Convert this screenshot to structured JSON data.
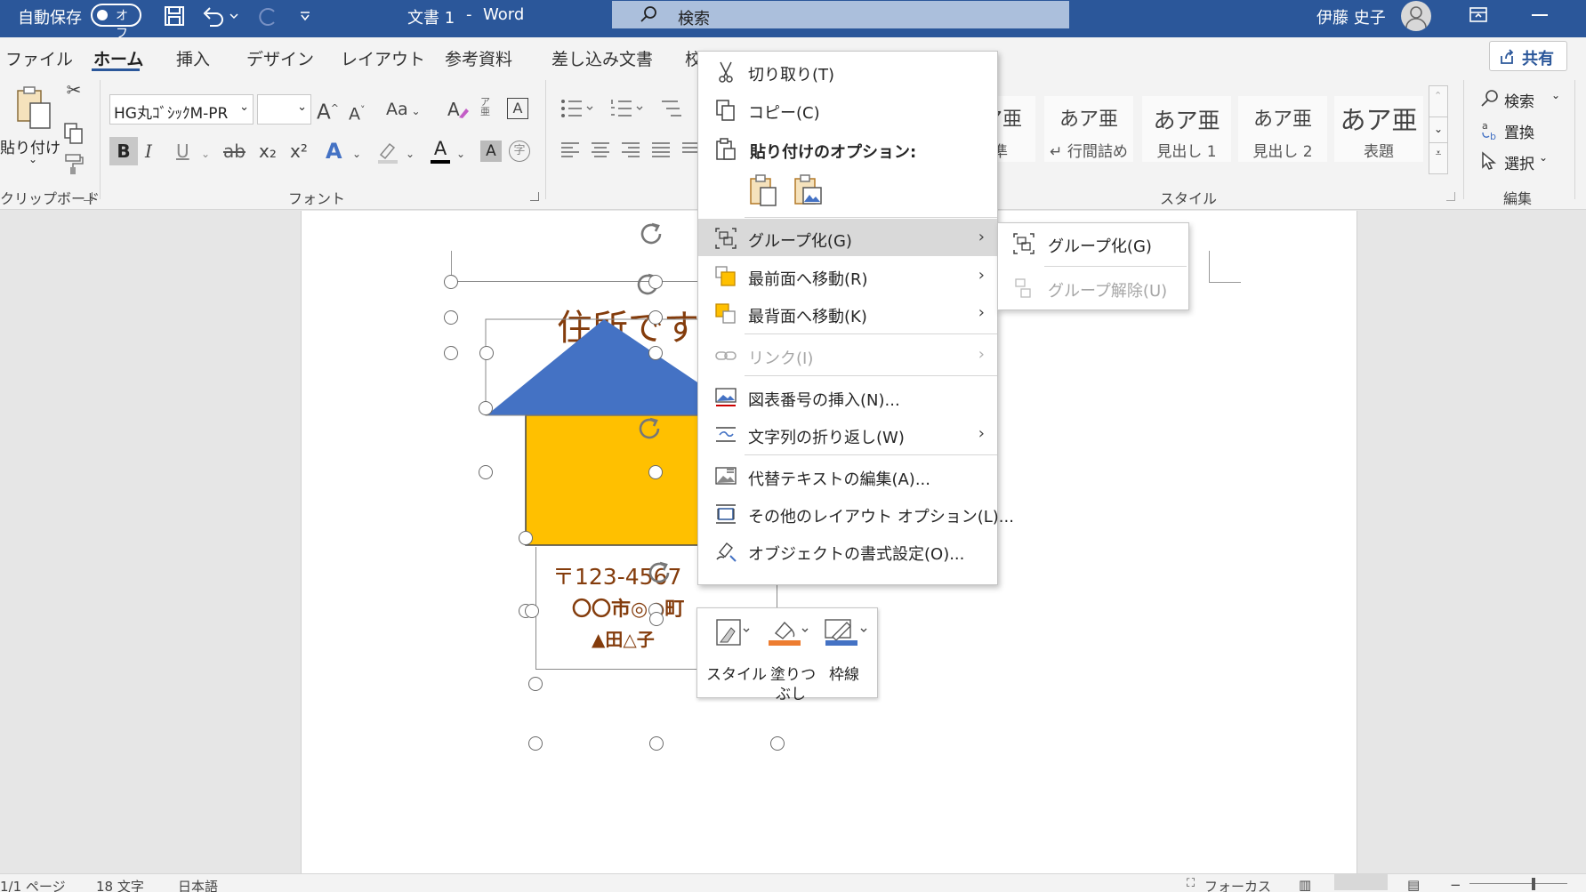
{
  "titlebar": {
    "autosave_label": "自動保存",
    "autosave_state": "オフ",
    "doc_title": "文書 1",
    "separator": "-",
    "app_name": "Word",
    "search_placeholder": "検索",
    "user_name": "伊藤 史子"
  },
  "tabs": [
    "ファイル",
    "ホーム",
    "挿入",
    "デザイン",
    "レイアウト",
    "参考資料",
    "差し込み文書",
    "校閲"
  ],
  "active_tab": "ホーム",
  "share_label": "共有",
  "ribbon": {
    "clipboard": {
      "paste_label": "貼り付け",
      "group_label": "クリップボード"
    },
    "font": {
      "font_name": "HG丸ｺﾞｼｯｸM-PR",
      "font_size": "",
      "group_label": "フォント",
      "glyphs": {
        "grow": "A",
        "shrink": "A",
        "case": "Aa",
        "bold": "B",
        "italic": "I",
        "underline": "U",
        "strike": "ab",
        "sub": "x₂",
        "sup": "x²",
        "effect": "A",
        "highlight": "✎",
        "color": "A",
        "char_shade": "A",
        "enclose": "字"
      }
    },
    "styles": {
      "items": [
        {
          "preview": "あア亜",
          "name": "標準"
        },
        {
          "preview": "あア亜",
          "name": "↵ 行間詰め"
        },
        {
          "preview": "あア亜",
          "name": "見出し 1"
        },
        {
          "preview": "あア亜",
          "name": "見出し 2"
        },
        {
          "preview": "あア亜",
          "name": "表題"
        }
      ],
      "group_label": "スタイル"
    },
    "editing": {
      "find": "検索",
      "replace": "置換",
      "select": "選択",
      "group_label": "編集"
    }
  },
  "document": {
    "title_text": "住所です",
    "postal": "〒123-4567",
    "address": "〇〇市◎◎町",
    "name": "▲田△子",
    "colors": {
      "roof": "#4472c4",
      "body": "#ffc000",
      "title": "#843c0c",
      "address": "#843c0c"
    }
  },
  "context_menu": {
    "items": [
      {
        "label": "切り取り(T)",
        "icon": "scissors-icon",
        "enabled": true,
        "submenu": false
      },
      {
        "label": "コピー(C)",
        "icon": "copy-icon",
        "enabled": true,
        "submenu": false
      },
      {
        "label": "貼り付けのオプション:",
        "icon": "paste-icon",
        "enabled": true,
        "submenu": false
      },
      {
        "label": "グループ化(G)",
        "icon": "group-icon",
        "enabled": true,
        "submenu": true,
        "highlighted": true
      },
      {
        "label": "最前面へ移動(R)",
        "icon": "bring-front-icon",
        "enabled": true,
        "submenu": true
      },
      {
        "label": "最背面へ移動(K)",
        "icon": "send-back-icon",
        "enabled": true,
        "submenu": true
      },
      {
        "label": "リンク(I)",
        "icon": "link-icon",
        "enabled": false,
        "submenu": true
      },
      {
        "label": "図表番号の挿入(N)...",
        "icon": "caption-icon",
        "enabled": true,
        "submenu": false
      },
      {
        "label": "文字列の折り返し(W)",
        "icon": "wrap-text-icon",
        "enabled": true,
        "submenu": true
      },
      {
        "label": "代替テキストの編集(A)...",
        "icon": "alt-text-icon",
        "enabled": true,
        "submenu": false
      },
      {
        "label": "その他のレイアウト オプション(L)...",
        "icon": "layout-options-icon",
        "enabled": true,
        "submenu": false
      },
      {
        "label": "オブジェクトの書式設定(O)...",
        "icon": "format-object-icon",
        "enabled": true,
        "submenu": false
      }
    ]
  },
  "submenu": {
    "items": [
      {
        "label": "グループ化(G)",
        "enabled": true
      },
      {
        "label": "グループ解除(U)",
        "enabled": false
      }
    ]
  },
  "mini_toolbar": {
    "style": "スタイル",
    "fill_line1": "塗りつ",
    "fill_line2": "ぶし",
    "outline": "枠線",
    "fill_color": "#ed7d31",
    "outline_color": "#4472c4"
  },
  "statusbar": {
    "page": "1/1 ページ",
    "words": "18 文字",
    "language": "日本語",
    "focus": "フォーカス"
  }
}
